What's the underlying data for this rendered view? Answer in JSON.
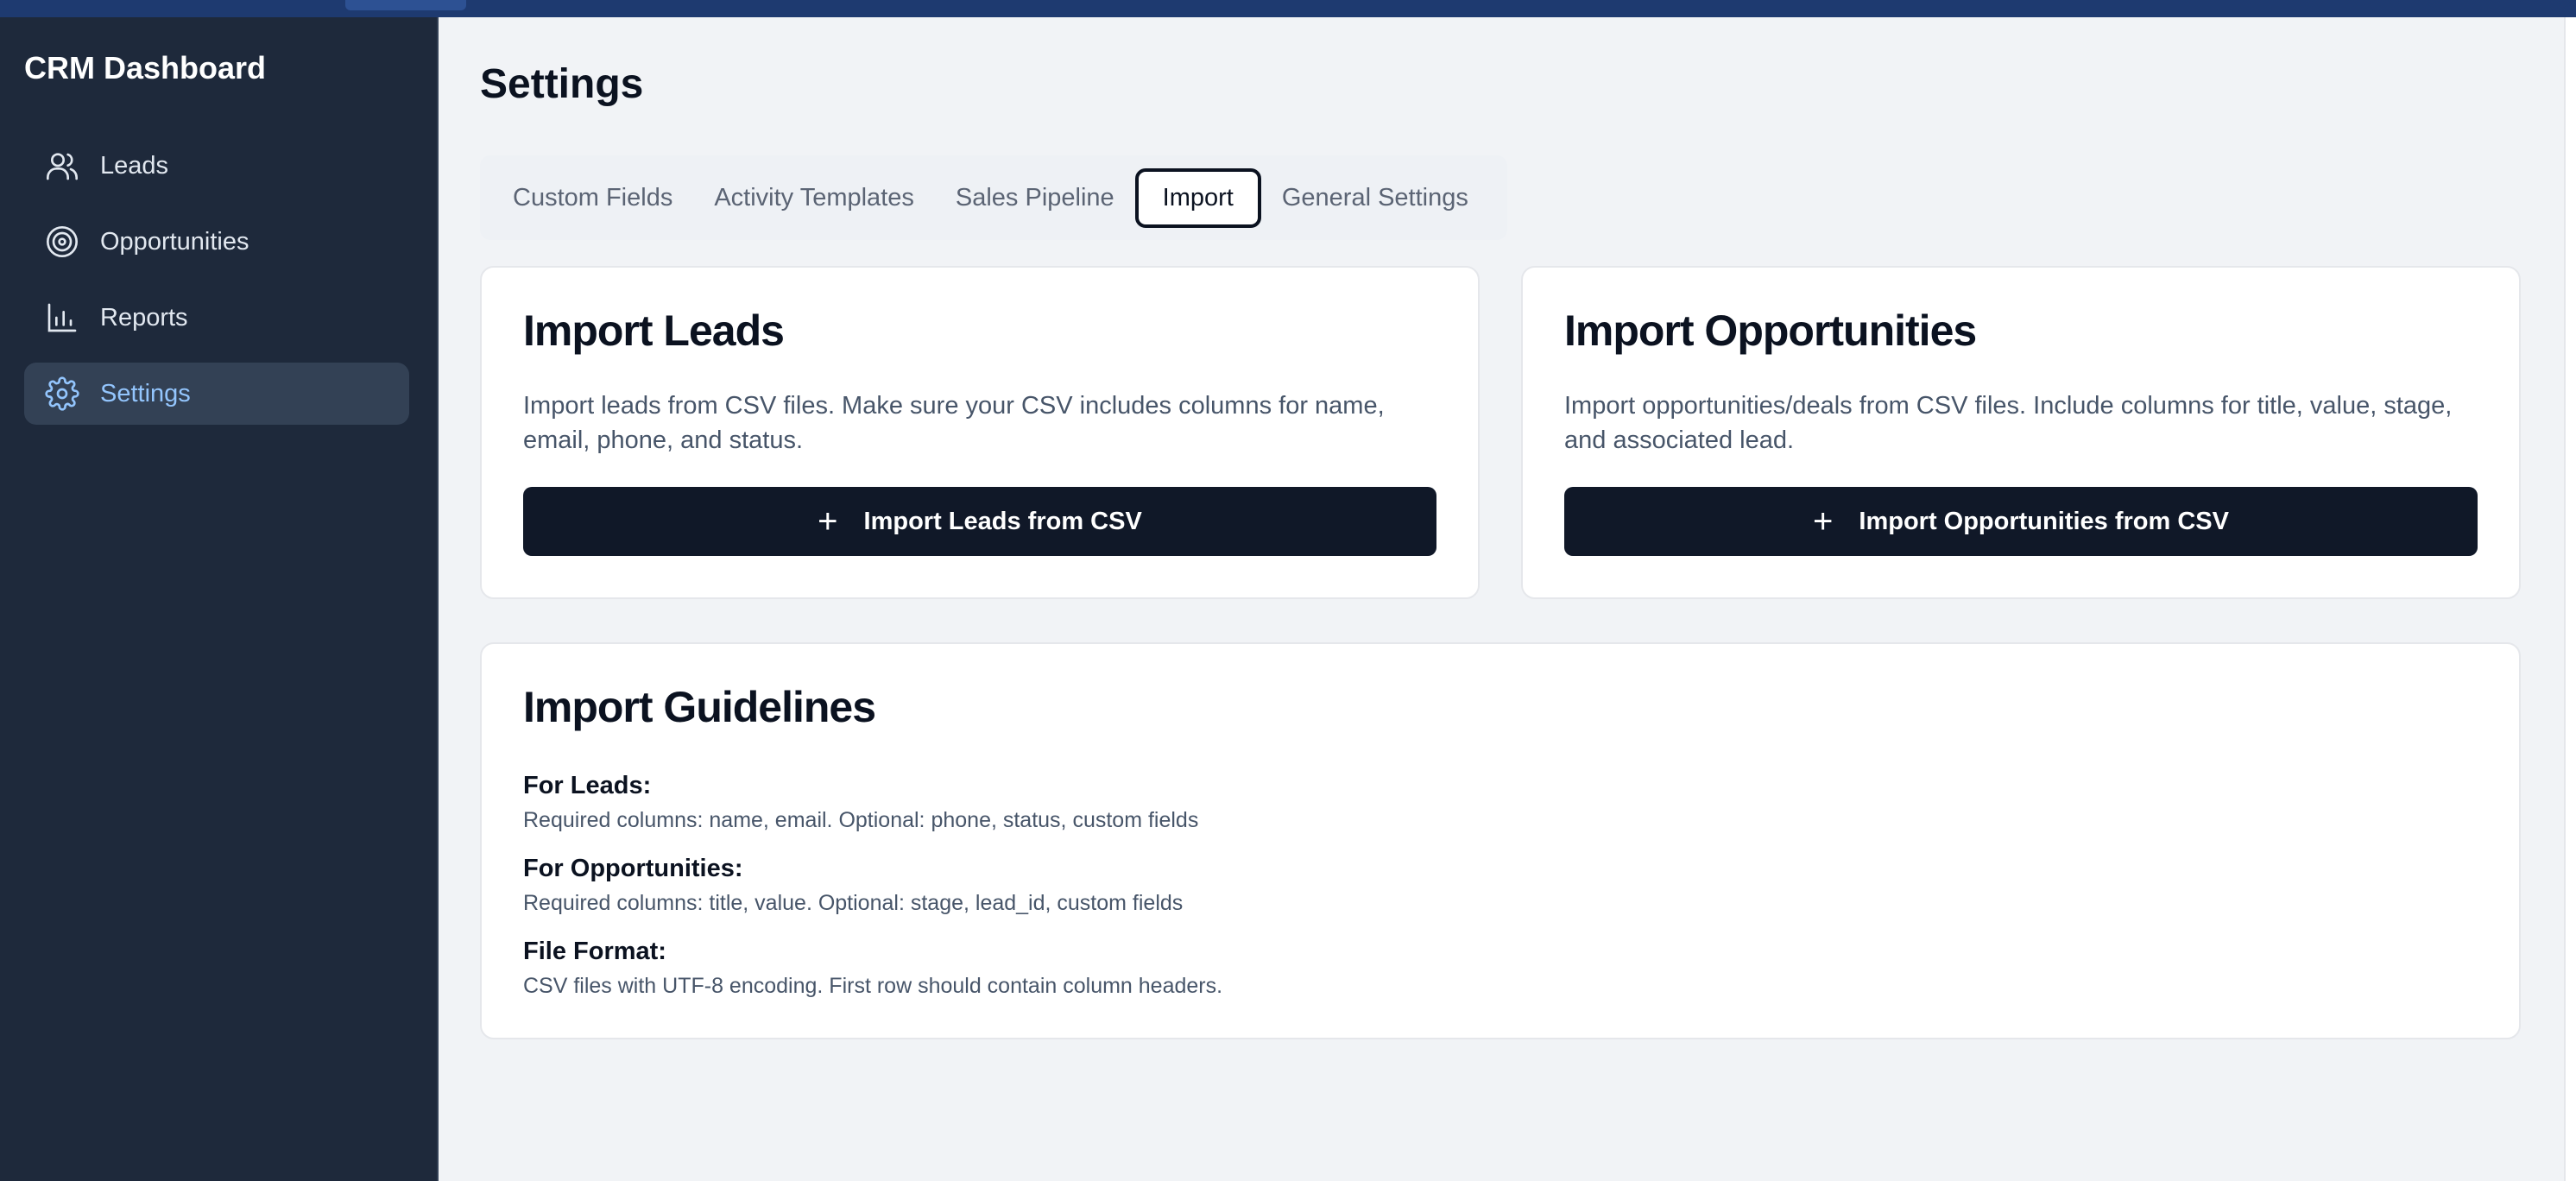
{
  "app": {
    "title": "CRM Dashboard"
  },
  "sidebar": {
    "items": [
      {
        "label": "Leads",
        "icon": "users-icon",
        "active": false
      },
      {
        "label": "Opportunities",
        "icon": "target-icon",
        "active": false
      },
      {
        "label": "Reports",
        "icon": "bar-chart-icon",
        "active": false
      },
      {
        "label": "Settings",
        "icon": "gear-icon",
        "active": true
      }
    ]
  },
  "page": {
    "title": "Settings"
  },
  "tabs": [
    {
      "label": "Custom Fields",
      "active": false
    },
    {
      "label": "Activity Templates",
      "active": false
    },
    {
      "label": "Sales Pipeline",
      "active": false
    },
    {
      "label": "Import",
      "active": true
    },
    {
      "label": "General Settings",
      "active": false
    }
  ],
  "import_leads": {
    "title": "Import Leads",
    "description": "Import leads from CSV files. Make sure your CSV includes columns for name, email, phone, and status.",
    "button_label": "Import Leads from CSV",
    "button_icon": "plus-icon"
  },
  "import_opportunities": {
    "title": "Import Opportunities",
    "description": "Import opportunities/deals from CSV files. Include columns for title, value, stage, and associated lead.",
    "button_label": "Import Opportunities from CSV",
    "button_icon": "plus-icon"
  },
  "guidelines": {
    "title": "Import Guidelines",
    "sections": [
      {
        "heading": "For Leads:",
        "text": "Required columns: name, email. Optional: phone, status, custom fields"
      },
      {
        "heading": "For Opportunities:",
        "text": "Required columns: title, value. Optional: stage, lead_id, custom fields"
      },
      {
        "heading": "File Format:",
        "text": "CSV files with UTF-8 encoding. First row should contain column headers."
      }
    ]
  },
  "colors": {
    "sidebar_bg": "#1e293b",
    "active_text": "#93c5fd",
    "primary_button": "#101828",
    "page_bg": "#f1f3f6"
  }
}
